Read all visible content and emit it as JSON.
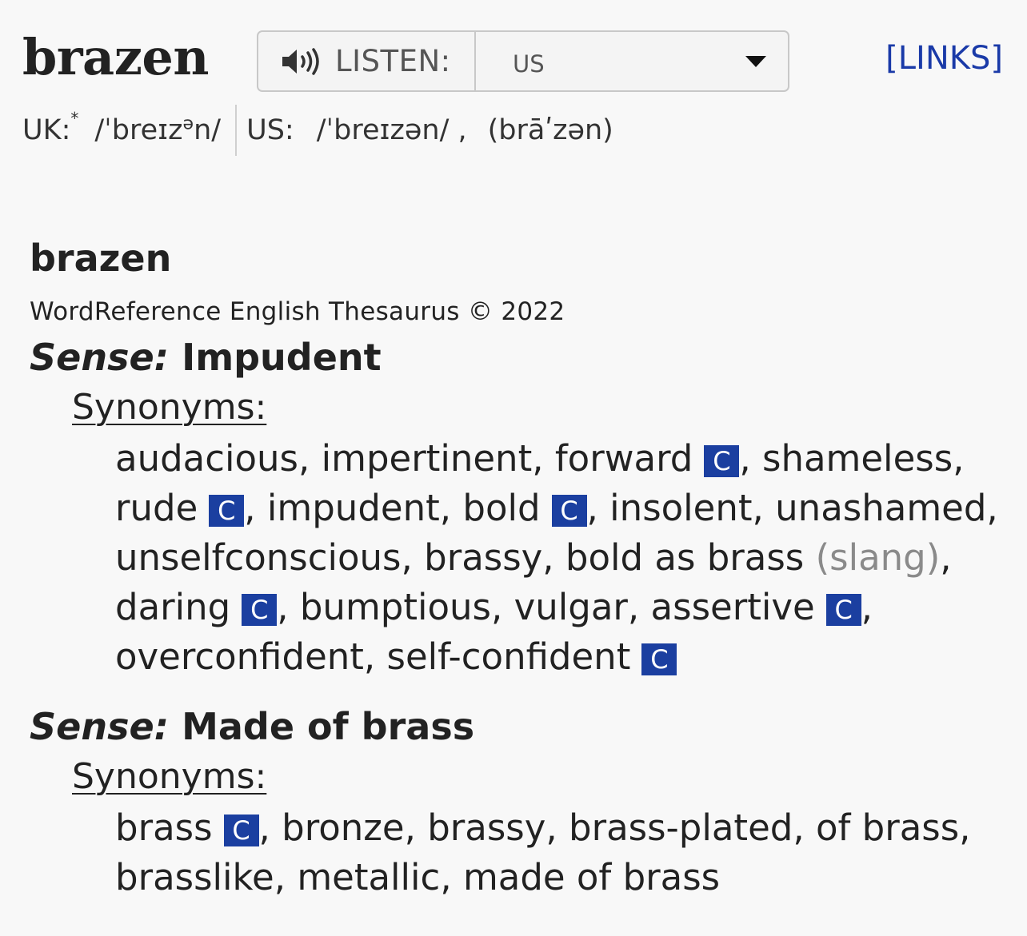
{
  "header": {
    "headword": "brazen",
    "listen_label": "LISTEN:",
    "accent_selected": "US",
    "links_label": "[LINKS]"
  },
  "pronunciation": {
    "uk_label": "UK:",
    "uk_marker": "*",
    "uk_ipa_before": "/ˈbreɪz",
    "uk_ipa_sup": "ə",
    "uk_ipa_after": "n/",
    "us_label": "US:",
    "us_ipa": "/ˈbreɪzən/ ,",
    "us_respelling": "(brāʹzən)"
  },
  "thesaurus": {
    "entry_word": "brazen",
    "source": "WordReference English Thesaurus © 2022",
    "badge_label": "C",
    "senses": [
      {
        "label": "Sense:",
        "name": "Impudent",
        "synonyms_label": "Synonyms:",
        "synonyms": [
          {
            "word": "audacious"
          },
          {
            "word": "impertinent"
          },
          {
            "word": "forward",
            "badge": true
          },
          {
            "word": "shameless"
          },
          {
            "word": "rude",
            "badge": true
          },
          {
            "word": "impudent"
          },
          {
            "word": "bold",
            "badge": true
          },
          {
            "word": "insolent"
          },
          {
            "word": "unashamed"
          },
          {
            "word": "unselfconscious"
          },
          {
            "word": "brassy"
          },
          {
            "word": "bold as brass",
            "note": "(slang)"
          },
          {
            "word": "daring",
            "badge": true
          },
          {
            "word": "bumptious"
          },
          {
            "word": "vulgar"
          },
          {
            "word": "assertive",
            "badge": true
          },
          {
            "word": "overconfident"
          },
          {
            "word": "self-confident",
            "badge": true
          }
        ]
      },
      {
        "label": "Sense:",
        "name": "Made of brass",
        "synonyms_label": "Synonyms:",
        "synonyms": [
          {
            "word": "brass",
            "badge": true
          },
          {
            "word": "bronze"
          },
          {
            "word": "brassy"
          },
          {
            "word": "brass-plated"
          },
          {
            "word": "of brass"
          },
          {
            "word": "brasslike"
          },
          {
            "word": "metallic"
          },
          {
            "word": "made of brass"
          }
        ]
      }
    ]
  },
  "colors": {
    "background": "#f8f8f8",
    "link": "#1a3aa8",
    "badge": "#1b3fa0",
    "note": "#8a8a8a"
  },
  "icons": {
    "speaker": "speaker-icon",
    "dropdown": "chevron-down-icon"
  }
}
